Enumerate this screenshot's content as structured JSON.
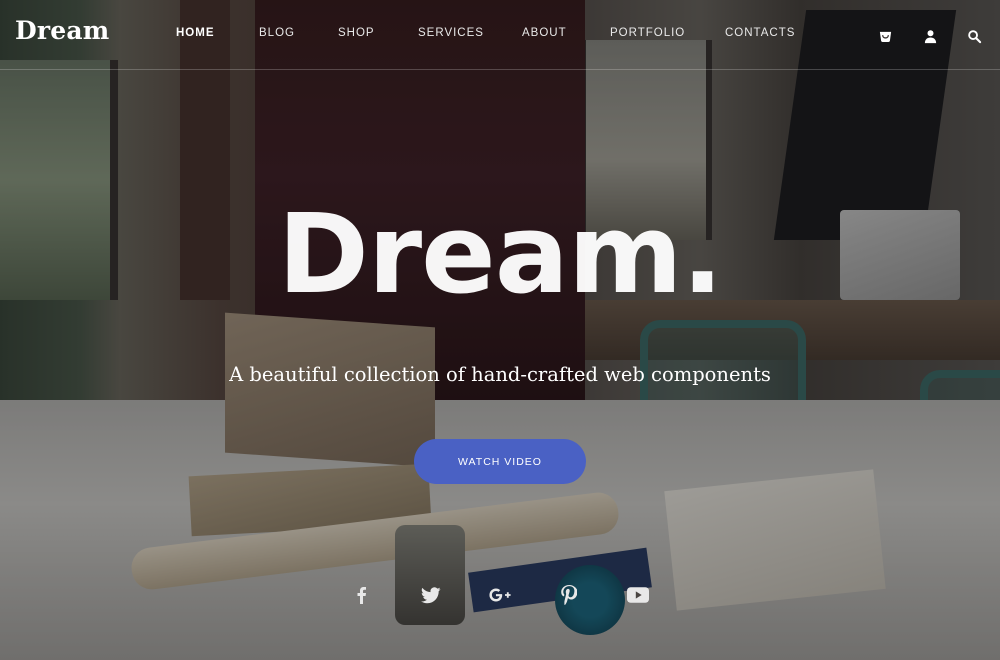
{
  "brand": {
    "logo_text": "Dream"
  },
  "nav": {
    "items": [
      {
        "label": "HOME",
        "active": true
      },
      {
        "label": "BLOG",
        "active": false
      },
      {
        "label": "SHOP",
        "active": false
      },
      {
        "label": "SERVICES",
        "active": false
      },
      {
        "label": "ABOUT",
        "active": false
      },
      {
        "label": "PORTFOLIO",
        "active": false
      },
      {
        "label": "CONTACTS",
        "active": false
      }
    ],
    "icons": [
      "cart-icon",
      "user-icon",
      "search-icon"
    ]
  },
  "hero": {
    "title": "Dream.",
    "subtitle": "A beautiful collection of hand-crafted web components",
    "cta_label": "WATCH VIDEO"
  },
  "social": [
    "facebook-icon",
    "twitter-icon",
    "google-plus-icon",
    "pinterest-icon",
    "youtube-icon"
  ],
  "colors": {
    "accent": "#4a61c4",
    "text": "#ffffff"
  }
}
